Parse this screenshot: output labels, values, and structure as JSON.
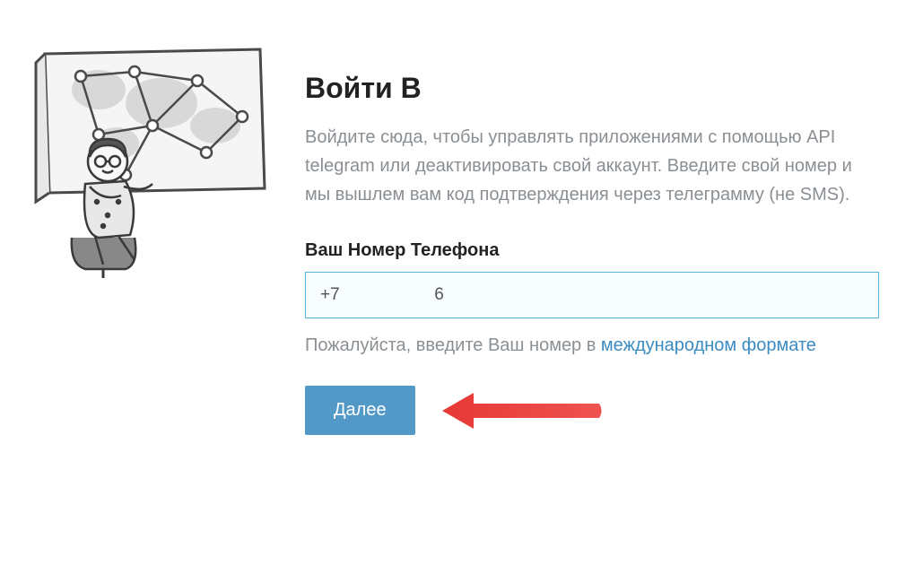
{
  "login": {
    "heading": "Войти В",
    "description": "Войдите сюда, чтобы управлять приложениями с помощью API telegram или деактивировать свой аккаунт. Введите свой номер и мы вышлем вам код подтверждения через телеграмму (не SMS).",
    "phone_label": "Ваш Номер Телефона",
    "phone_value": "+7                    6",
    "helper_text": "Пожалуйста, введите Ваш номер в ",
    "helper_link": "международном формате",
    "next_button": "Далее"
  }
}
